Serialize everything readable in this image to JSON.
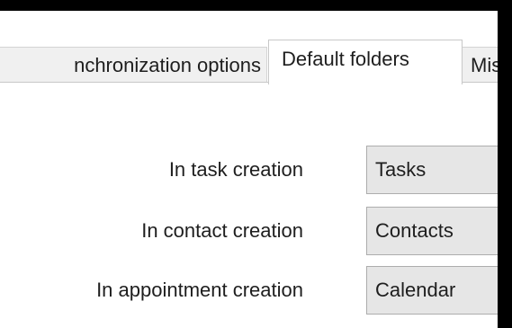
{
  "tabs": [
    {
      "label": "nchronization options",
      "active": false
    },
    {
      "label": "Default folders",
      "active": true
    },
    {
      "label": "Mis",
      "active": false
    }
  ],
  "rows": [
    {
      "label": "In task creation",
      "value": "Tasks"
    },
    {
      "label": "In contact creation",
      "value": "Contacts"
    },
    {
      "label": "In appointment creation",
      "value": "Calendar"
    }
  ],
  "colors": {
    "frame": "#000000",
    "panel": "#ffffff",
    "field_bg": "#e6e6e6",
    "field_border": "#adadad",
    "text": "#1e1e1e"
  }
}
